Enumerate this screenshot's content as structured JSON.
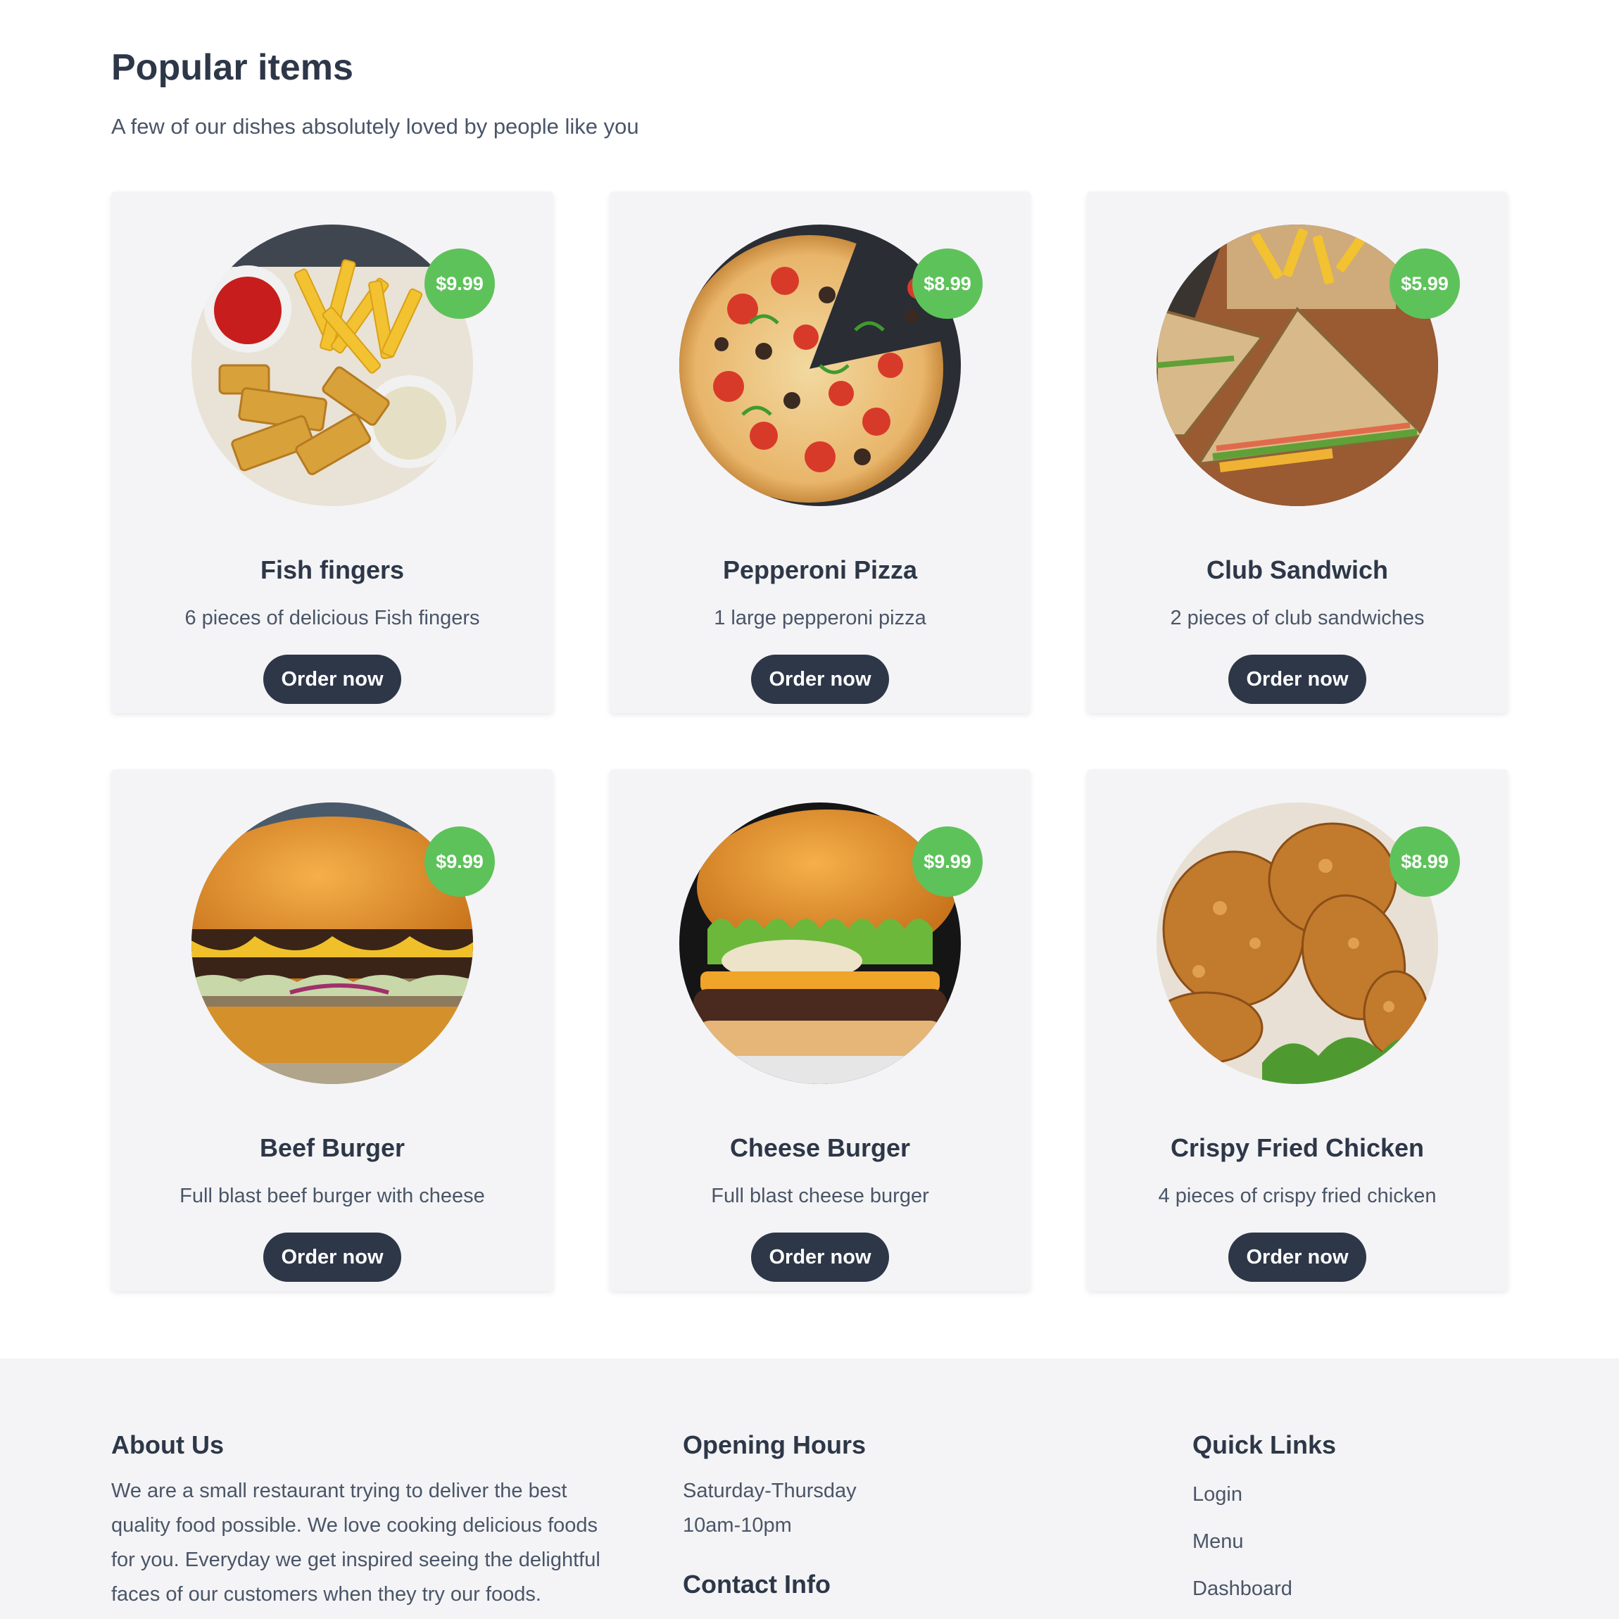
{
  "popular": {
    "title": "Popular items",
    "subtitle": "A few of our dishes absolutely loved by people like you",
    "order_label": "Order now",
    "items": [
      {
        "name": "Fish fingers",
        "description": "6 pieces of delicious Fish fingers",
        "price": "$9.99",
        "image": "fish-fingers-photo"
      },
      {
        "name": "Pepperoni Pizza",
        "description": "1 large pepperoni pizza",
        "price": "$8.99",
        "image": "pepperoni-pizza-photo"
      },
      {
        "name": "Club Sandwich",
        "description": "2 pieces of club sandwiches",
        "price": "$5.99",
        "image": "club-sandwich-photo"
      },
      {
        "name": "Beef Burger",
        "description": "Full blast beef burger with cheese",
        "price": "$9.99",
        "image": "beef-burger-photo"
      },
      {
        "name": "Cheese Burger",
        "description": "Full blast cheese burger",
        "price": "$9.99",
        "image": "cheese-burger-photo"
      },
      {
        "name": "Crispy Fried Chicken",
        "description": "4 pieces of crispy fried chicken",
        "price": "$8.99",
        "image": "fried-chicken-photo"
      }
    ]
  },
  "footer": {
    "about": {
      "heading": "About Us",
      "text": "We are a small restaurant trying to deliver the best quality food possible. We love cooking delicious foods for you. Everyday we get inspired seeing the delightful faces of our customers when they try our foods."
    },
    "hours": {
      "heading": "Opening Hours",
      "days": "Saturday-Thursday",
      "time": "10am-10pm"
    },
    "contact": {
      "heading": "Contact Info"
    },
    "links": {
      "heading": "Quick Links",
      "items": [
        "Login",
        "Menu",
        "Dashboard"
      ]
    }
  },
  "colors": {
    "primary_dark": "#2d3748",
    "price_green": "#5ec25b",
    "card_bg": "#f4f4f6"
  }
}
